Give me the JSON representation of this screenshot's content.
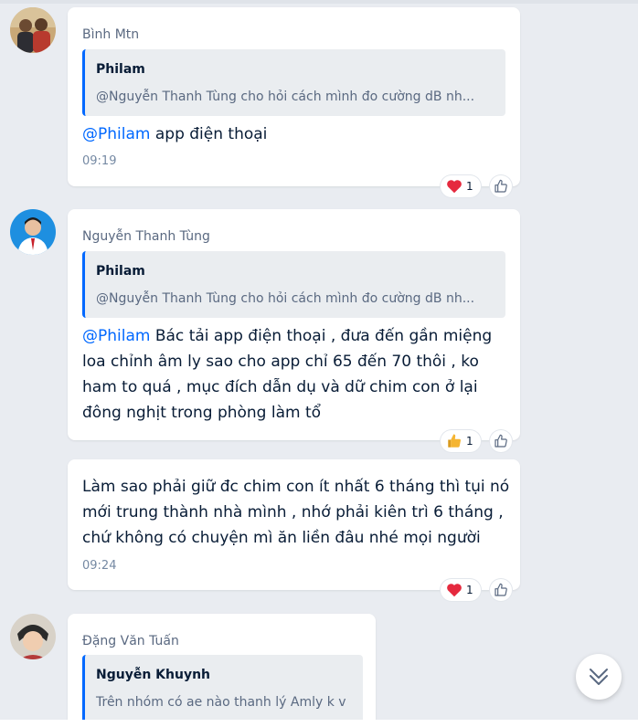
{
  "messages": [
    {
      "sender": "Bình Mtn",
      "quote": {
        "name": "Philam",
        "text": "@Nguyễn Thanh Tùng cho hỏi cách mình đo cường dB nh..."
      },
      "mention": "@Philam",
      "text": " app điện thoại",
      "time": "09:19",
      "reaction": {
        "icon": "heart-icon",
        "count": "1"
      }
    },
    {
      "sender": "Nguyễn Thanh Tùng",
      "quote": {
        "name": "Philam",
        "text": "@Nguyễn Thanh Tùng cho hỏi cách mình đo cường dB nh..."
      },
      "mention": "@Philam",
      "lines": [
        " Bác tải app điện thoại , đưa đến gần miệng",
        "loa chỉnh âm ly sao cho app chỉ 65 đến 70 thôi , ko",
        "ham to quá , mục đích dẫn dụ và dữ chim con ở lại",
        "đông nghịt trong phòng làm tổ"
      ],
      "reaction": {
        "icon": "thumbs-up-icon",
        "count": "1"
      }
    },
    {
      "lines": [
        "Làm sao phải giữ đc chim con ít nhất 6 tháng thì tụi nó",
        "mới trung thành nhà mình , nhớ phải kiên trì 6 tháng ,",
        "chứ không có chuyện mì ăn liền đâu nhé mọi người"
      ],
      "time": "09:24",
      "reaction": {
        "icon": "heart-icon",
        "count": "1"
      }
    },
    {
      "sender": "Đặng Văn Tuấn",
      "quote": {
        "name": "Nguyễn Khuynh",
        "text": "Trên nhóm có ae nào thanh lý Amly k v"
      }
    }
  ],
  "colors": {
    "accent": "#0068ff",
    "heart": "#e5293e",
    "background": "#e9ecf1"
  },
  "icons": {
    "like": "like-icon",
    "scroll": "double-chevron-down-icon"
  }
}
